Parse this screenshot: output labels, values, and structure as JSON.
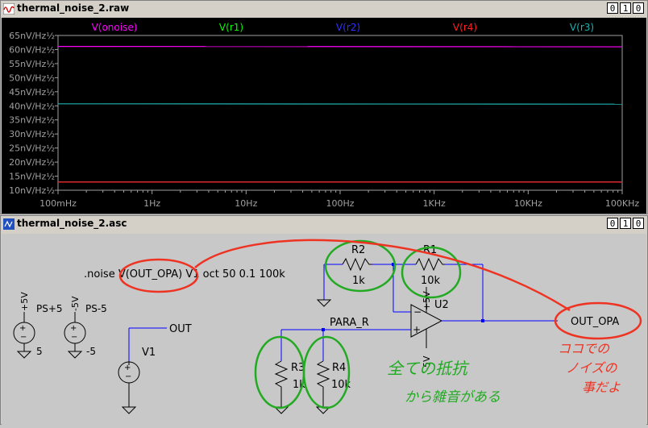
{
  "waveform_window": {
    "title": "thermal_noise_2.raw",
    "buttons": [
      "0",
      "1",
      "0"
    ]
  },
  "schematic_window": {
    "title": "thermal_noise_2.asc",
    "buttons": [
      "0",
      "1",
      "0"
    ]
  },
  "chart_data": {
    "type": "line",
    "title": "",
    "xlabel": "",
    "ylabel": "",
    "x_scale": "log",
    "xlim": [
      0.1,
      100000
    ],
    "ylim": [
      10,
      65
    ],
    "grid": false,
    "x_ticks": [
      {
        "value": 0.1,
        "label": "100mHz"
      },
      {
        "value": 1,
        "label": "1Hz"
      },
      {
        "value": 10,
        "label": "10Hz"
      },
      {
        "value": 100,
        "label": "100Hz"
      },
      {
        "value": 1000,
        "label": "1KHz"
      },
      {
        "value": 10000,
        "label": "10KHz"
      },
      {
        "value": 100000,
        "label": "100KHz"
      }
    ],
    "y_ticks": [
      {
        "value": 65,
        "label": "65nV/Hz½"
      },
      {
        "value": 60,
        "label": "60nV/Hz½"
      },
      {
        "value": 55,
        "label": "55nV/Hz½"
      },
      {
        "value": 50,
        "label": "50nV/Hz½"
      },
      {
        "value": 45,
        "label": "45nV/Hz½"
      },
      {
        "value": 40,
        "label": "40nV/Hz½"
      },
      {
        "value": 35,
        "label": "35nV/Hz½"
      },
      {
        "value": 30,
        "label": "30nV/Hz½"
      },
      {
        "value": 25,
        "label": "25nV/Hz½"
      },
      {
        "value": 20,
        "label": "20nV/Hz½"
      },
      {
        "value": 15,
        "label": "15nV/Hz½"
      },
      {
        "value": 10,
        "label": "10nV/Hz½"
      }
    ],
    "series": [
      {
        "name": "V(onoise)",
        "color": "#ff00ff",
        "x": [
          0.1,
          100000
        ],
        "values": [
          61.1,
          61.0
        ]
      },
      {
        "name": "V(r1)",
        "color": "#00ff00",
        "x": [
          0.1,
          100000
        ],
        "values": [
          12.9,
          12.9
        ]
      },
      {
        "name": "V(r2)",
        "color": "#3030ff",
        "x": [
          0.1,
          100000
        ],
        "values": [
          12.9,
          12.9
        ]
      },
      {
        "name": "V(r4)",
        "color": "#ff2020",
        "x": [
          0.1,
          100000
        ],
        "values": [
          12.9,
          12.9
        ]
      },
      {
        "name": "V(r3)",
        "color": "#20b0b0",
        "x": [
          0.1,
          100000
        ],
        "values": [
          40.7,
          40.6
        ]
      }
    ]
  },
  "schematic": {
    "directive": ".noise V(OUT_OPA) V1 oct 50 0.1 100k",
    "components": {
      "r1": {
        "name": "R1",
        "value": "10k"
      },
      "r2": {
        "name": "R2",
        "value": "1k"
      },
      "r3": {
        "name": "R3",
        "value": "1k"
      },
      "r4": {
        "name": "R4",
        "value": "10k"
      },
      "u2": {
        "name": "U2",
        "vplus": "+5V",
        "vminus": "-5V"
      },
      "v1": {
        "name": "V1"
      },
      "ps_pos": {
        "name": "PS+5",
        "top": "+5V",
        "value": "5"
      },
      "ps_neg": {
        "name": "PS-5",
        "top": "-5V",
        "value": "-5"
      }
    },
    "nets": {
      "out": "OUT",
      "para_r": "PARA_R",
      "out_opa": "OUT_OPA"
    },
    "annotations": {
      "green": [
        "全ての抵抗",
        "から雑音がある"
      ],
      "red": [
        "ココでの",
        "ノイズの",
        "事だよ"
      ]
    },
    "colors": {
      "wire": "#0000ff",
      "component": "#000000",
      "annotation_green": "#22aa22",
      "annotation_red": "#ee3322"
    }
  }
}
